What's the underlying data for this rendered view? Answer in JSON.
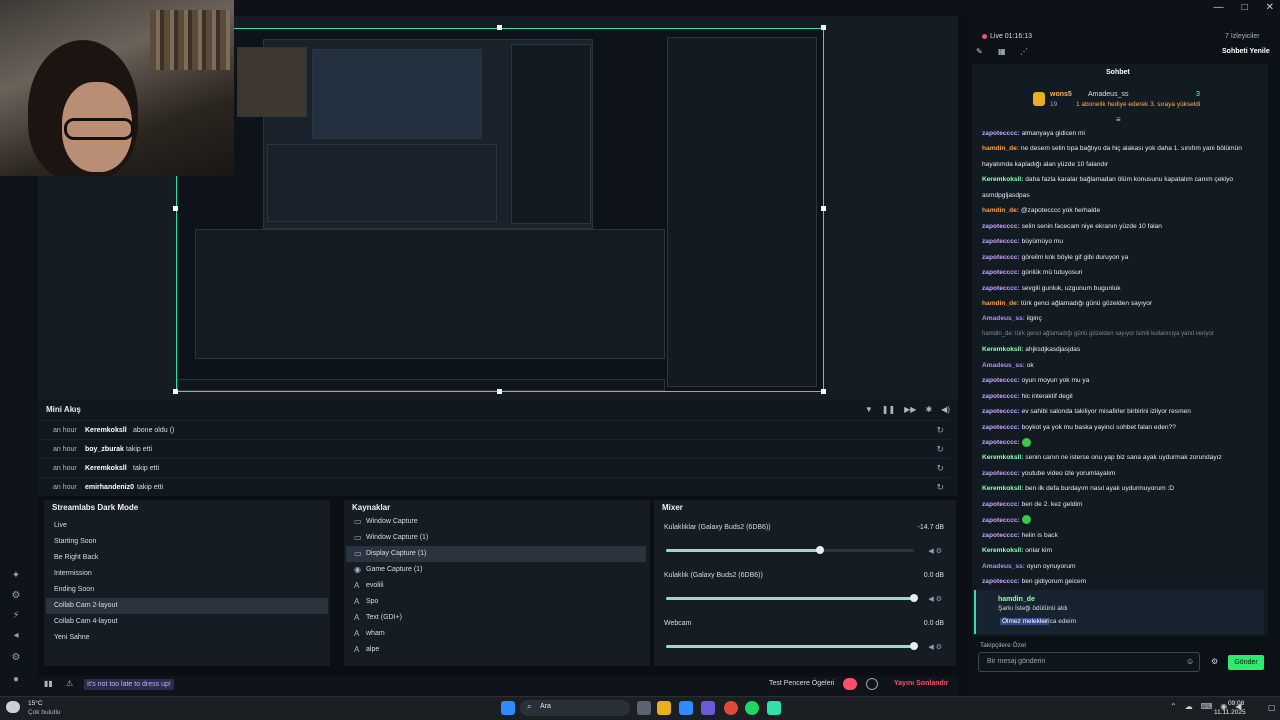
{
  "window": {
    "controls": [
      "—",
      "□",
      "✕"
    ]
  },
  "leftnav_icons": [
    "studio-icon",
    "layout-icon",
    "bolt-icon",
    "gear-icon",
    "account-icon"
  ],
  "mini": {
    "title": "Mini Akış",
    "events": [
      {
        "time": "an hour",
        "user": "Keremkoksll",
        "action": "abone oldu ()"
      },
      {
        "time": "an hour",
        "user": "boy_zburak",
        "action": "takip etti"
      },
      {
        "time": "an hour",
        "user": "Keremkoksll",
        "action": "takip etti"
      },
      {
        "time": "an hour",
        "user": "emirhandeniz0",
        "action": "takip etti"
      }
    ]
  },
  "scenes": {
    "title": "Streamlabs Dark Mode",
    "items": [
      "Live",
      "Starting Soon",
      "Be Right Back",
      "Intermission",
      "Ending Soon",
      "Collab Cam 2-layout",
      "Collab Cam 4-layout",
      "Yeni Sahne"
    ],
    "selected": "Collab Cam 2-layout"
  },
  "sources": {
    "title": "Kaynaklar",
    "items": [
      "Window Capture",
      "Window Capture (1)",
      "Display Capture (1)",
      "Game Capture (1)",
      "evolili",
      "Spo",
      "Text (GDI+)",
      "wham",
      "alpe"
    ],
    "selected": "Display Capture (1)"
  },
  "mixer": {
    "title": "Mixer",
    "channels": [
      {
        "name": "Kulaklıklar (Galaxy Buds2 (6DB6))",
        "db": "-14.7 dB",
        "level": 0.62
      },
      {
        "name": "Kulaklık (Galaxy Buds2 (6DB6))",
        "db": "0.0 dB",
        "level": 1.0
      },
      {
        "name": "Webcam",
        "db": "0.0 dB",
        "level": 1.0
      }
    ]
  },
  "footer": {
    "dressup": "It's not too late to dress up!",
    "test_label": "Test Pencere Ögeleri",
    "golive": "Yayını Sonlandır"
  },
  "chat": {
    "live": "Live 01:16:13",
    "viewers": "7 İzleyiciler",
    "reload": "Sohbeti Yenile",
    "tab": "Sohbet",
    "sub_user": "wons5",
    "sub_target": "Amadeus_ss",
    "sub_count": "3",
    "sub_count2": "19",
    "sub_text": "1 abonelik hediye ederek 3. sıraya yükseldi",
    "lines": [
      {
        "user": "zapotecccc:",
        "cls": "z",
        "text": "almanyaya gidicen mi"
      },
      {
        "user": "hamdin_de:",
        "cls": "h",
        "text": "ne desem selin tıpa bağlıyo da hiç alakası yok daha 1. sınıfım yani bölümün"
      },
      {
        "user": "",
        "cls": "",
        "text": "hayatımda kapladığı alan yüzde 10 falandır"
      },
      {
        "user": "Keremkoksll:",
        "cls": "k",
        "text": "daha fazla karalar bağlamadan ölüm konusunu kapatalım canım çekiyo"
      },
      {
        "user": "",
        "cls": "",
        "text": "asmdpgljasdpas"
      },
      {
        "user": "hamdin_de:",
        "cls": "h",
        "text": "@zapotecccc yok herhalde"
      },
      {
        "user": "zapotecccc:",
        "cls": "z",
        "text": "selin senin facecam niye ekranın yüzde 10 falan"
      },
      {
        "user": "zapotecccc:",
        "cls": "z",
        "text": "büyümüyo mu"
      },
      {
        "user": "zapotecccc:",
        "cls": "z",
        "text": "göreilm knk böyle gif gibi duruyon ya"
      },
      {
        "user": "zapotecccc:",
        "cls": "z",
        "text": "günlük mü tutuyosun"
      },
      {
        "user": "zapotecccc:",
        "cls": "z",
        "text": "sevgili gunluk, uzgunum bugunluk"
      },
      {
        "user": "hamdin_de:",
        "cls": "h",
        "text": "türk genci ağlamadığı günü gözelden sayıyor"
      },
      {
        "user": "Amadeus_ss:",
        "cls": "a",
        "text": "ilginç"
      },
      {
        "user": "",
        "cls": "",
        "text": "hamdin_de: türk genci ağlamadığı günü gözelden sayıyor isimli kullanıcıya yanıt veriyor"
      },
      {
        "user": "Keremkoksll:",
        "cls": "k",
        "text": "ahjksdjkasdjasjdas"
      },
      {
        "user": "Amadeus_ss:",
        "cls": "a",
        "text": "ok"
      },
      {
        "user": "zapotecccc:",
        "cls": "z",
        "text": "oyun moyun yok mu ya"
      },
      {
        "user": "zapotecccc:",
        "cls": "z",
        "text": "hic interaktif degil"
      },
      {
        "user": "zapotecccc:",
        "cls": "z",
        "text": "ev sahibi salonda takiliyor misafirler birbirini izliyor resmen"
      },
      {
        "user": "zapotecccc:",
        "cls": "z",
        "text": "boykot ya yok mu baska yayinci sohbet falan eden??"
      },
      {
        "user": "zapotecccc:",
        "cls": "z",
        "text": ""
      },
      {
        "user": "Keremkoksll:",
        "cls": "k",
        "text": "senin canın ne isterse onu yap biz sana ayak uydurmak zorundayız"
      },
      {
        "user": "zapotecccc:",
        "cls": "z",
        "text": "youtube video izle yorumlayalım"
      },
      {
        "user": "Keremkoksll:",
        "cls": "k",
        "text": "ben ilk defa burdayım nasıl ayak uydurmuyorum :D"
      },
      {
        "user": "zapotecccc:",
        "cls": "z",
        "text": "ben de 2. kez geldim"
      },
      {
        "user": "zapotecccc:",
        "cls": "z",
        "text": ""
      },
      {
        "user": "zapotecccc:",
        "cls": "z",
        "text": "helin is back"
      },
      {
        "user": "Keremkoksll:",
        "cls": "k",
        "text": "onlar kim"
      },
      {
        "user": "Amadeus_ss:",
        "cls": "a",
        "text": "oyun oynuyorum"
      },
      {
        "user": "zapotecccc:",
        "cls": "z",
        "text": "ben gidiyorum geicem"
      },
      {
        "user": "zapotecccc:",
        "cls": "z",
        "text": "yayın kaça kadar"
      }
    ],
    "redeem_user": "hamdin_de",
    "redeem_title": "Şarkı İsteği ödülünü aldı",
    "redeem_song": "Ölmez melekler",
    "redeem_tail": "rica edeim",
    "followers_only": "Takipçilere Özel",
    "placeholder": "Bir mesaj gönderin",
    "send": "Gönder"
  },
  "taskbar": {
    "weather_temp": "15°C",
    "weather_desc": "Çok bulutlu",
    "search": "Ara",
    "time": "09:08",
    "date": "11.11.2025"
  },
  "colors": {
    "accent": "#31e0a8",
    "live": "#ff4d6a",
    "send": "#31e96f"
  }
}
